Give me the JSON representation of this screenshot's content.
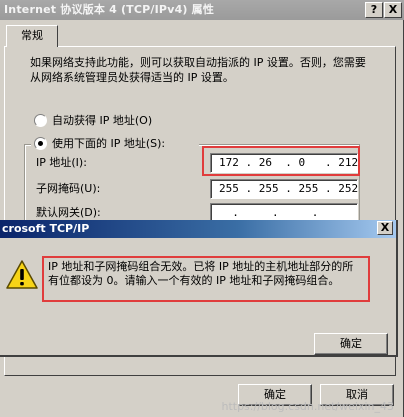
{
  "dialog": {
    "title": "Internet 协议版本 4 (TCP/IPv4) 属性",
    "help_btn": "?",
    "close_btn": "X",
    "tab": "常规",
    "description": "如果网络支持此功能，则可以获取自动指派的 IP 设置。否则，您需要从网络系统管理员处获得适当的 IP 设置。",
    "radio_auto": "自动获得 IP 地址(O)",
    "radio_manual": "使用下面的 IP 地址(S):",
    "ip_label": "IP 地址(I):",
    "ip_value": "172 . 26  . 0   . 212",
    "mask_label": "子网掩码(U):",
    "mask_value": "255 . 255 . 255 . 252",
    "gateway_label": "默认网关(D):",
    "gateway_value": "  .     .     .   ",
    "ok_button": "确定",
    "cancel_button": "取消"
  },
  "message_box": {
    "title": "crosoft TCP/IP",
    "close_btn": "X",
    "text": "IP 地址和子网掩码组合无效。已将 IP 地址的主机地址部分的所有位都设为 0。请输入一个有效的 IP 地址和子网掩码组合。",
    "ok_button": "确定",
    "icon": "warning-icon"
  },
  "watermark": "https://blog.csdn.net/weixin_43"
}
